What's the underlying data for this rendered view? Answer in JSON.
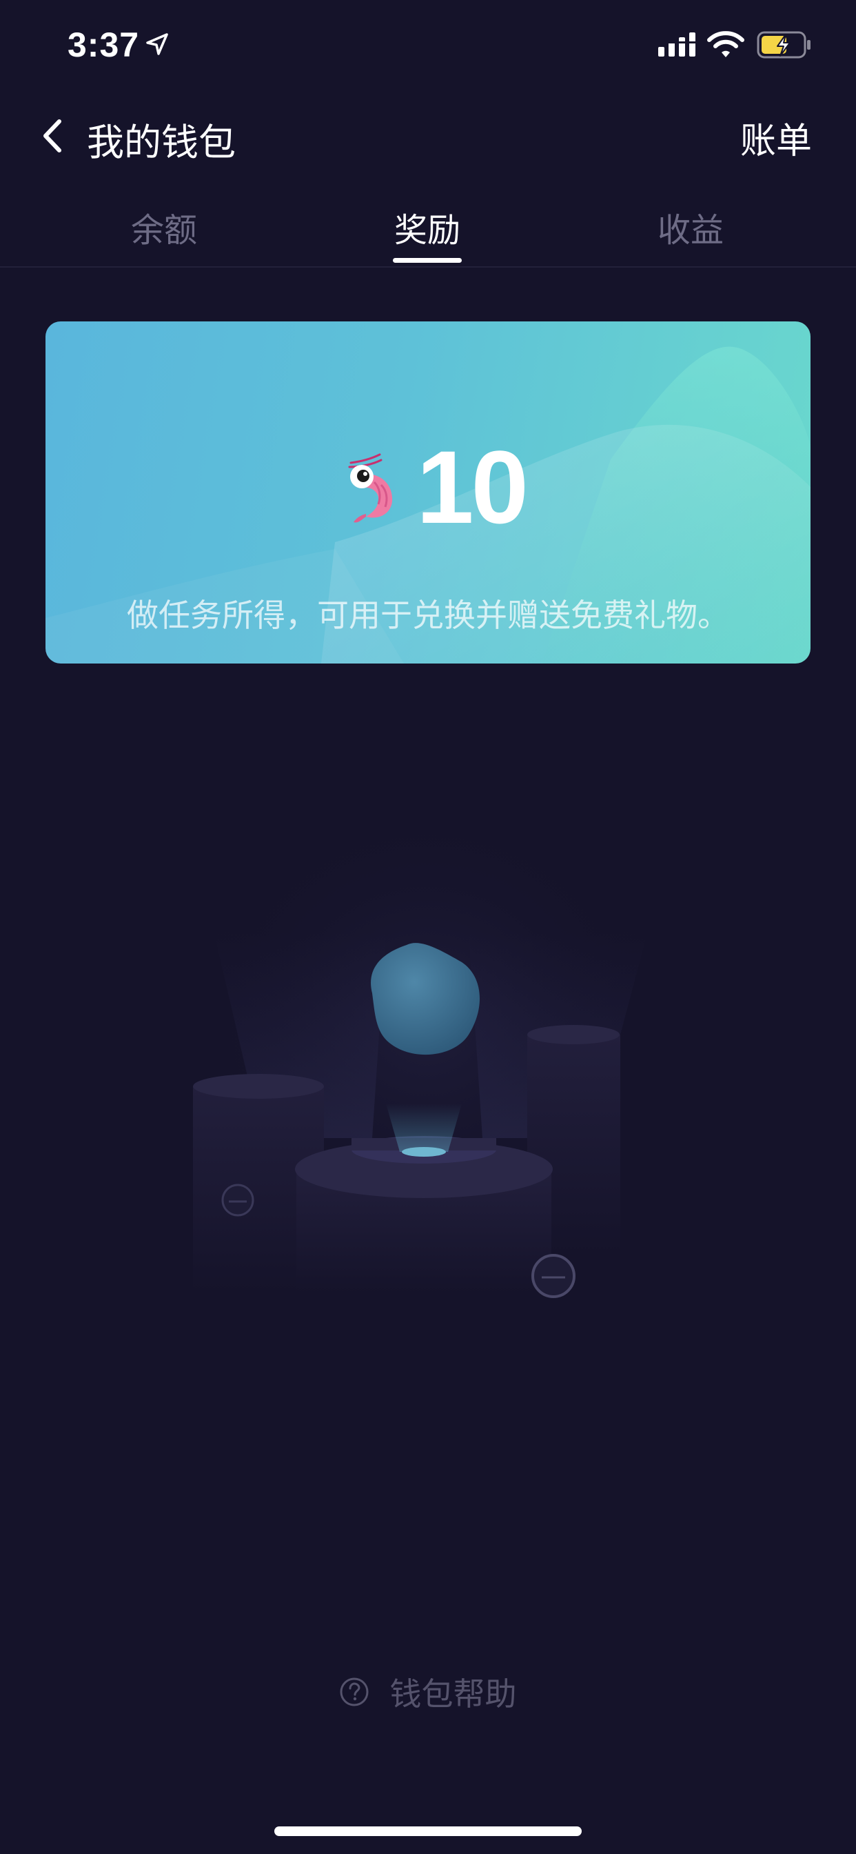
{
  "status_bar": {
    "time": "3:37"
  },
  "header": {
    "title": "我的钱包",
    "bill_label": "账单"
  },
  "tabs": [
    {
      "label": "余额",
      "active": false
    },
    {
      "label": "奖励",
      "active": true
    },
    {
      "label": "收益",
      "active": false
    }
  ],
  "reward_card": {
    "icon": "shrimp-icon",
    "amount": "10",
    "description": "做任务所得，可用于兑换并赠送免费礼物。"
  },
  "help": {
    "label": "钱包帮助",
    "icon": "question-circle-icon"
  },
  "colors": {
    "background": "#15132a",
    "card_gradient_start": "#5ab6dc",
    "card_gradient_end": "#6ad8cd",
    "tab_inactive": "#6e6c86",
    "help_text": "#55536c"
  }
}
